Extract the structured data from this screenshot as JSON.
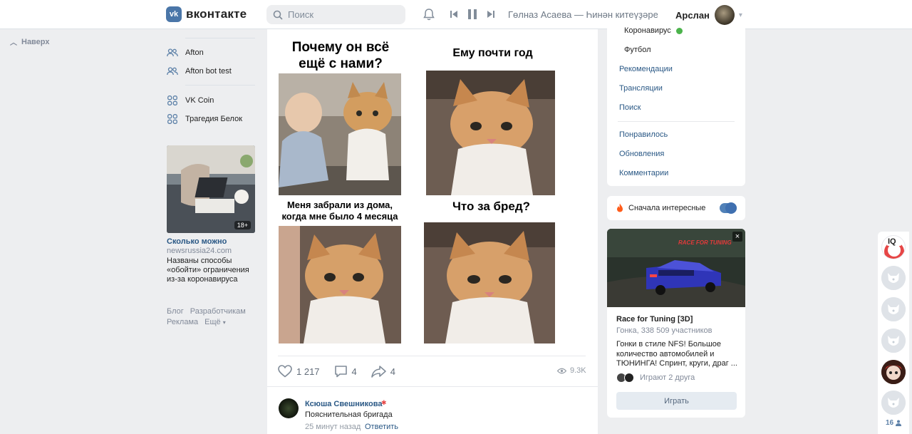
{
  "header": {
    "logo_mark": "vk",
    "logo_text": "вконтакте",
    "search_placeholder": "Поиск",
    "track": "Гөлназ Асаева — Һинән китеүҙәре...",
    "user_name": "Арслан"
  },
  "up_link": "Наверх",
  "left_nav": {
    "groups": [
      {
        "label": "Afton",
        "icon": "users-icon"
      },
      {
        "label": "Afton bot test",
        "icon": "users-icon"
      }
    ],
    "apps": [
      {
        "label": "VK Coin",
        "icon": "apps-icon"
      },
      {
        "label": "Трагедия Белок",
        "icon": "apps-icon"
      }
    ],
    "ad": {
      "badge": "18+",
      "title": "Сколько можно",
      "domain": "newsrussia24.com",
      "description": "Названы способы «обойти» ограничения из-за коронавируса"
    },
    "footer_row1": [
      "Блог",
      "Разработчикам"
    ],
    "footer_row2": [
      "Реклама",
      "Ещё"
    ]
  },
  "post": {
    "captions": {
      "top_left": "Почему он всё ещё с нами?",
      "top_right": "Ему почти год",
      "bottom_left": "Меня забрали из дома, когда мне было 4 месяца",
      "bottom_right": "Что за бред?"
    },
    "likes": "1 217",
    "comments": "4",
    "shares": "4",
    "views": "9.3K"
  },
  "comment": {
    "author": "Ксюша Свешникова",
    "flag": "✱",
    "text": "Пояснительная бригада",
    "time": "25 минут назад",
    "reply": "Ответить"
  },
  "right": {
    "sub_items": [
      "Коронавирус",
      "Футбол"
    ],
    "links1": [
      "Рекомендации",
      "Трансляции",
      "Поиск"
    ],
    "links2": [
      "Понравилось",
      "Обновления",
      "Комментарии"
    ],
    "interesting_label": "Сначала интересные",
    "interesting_on": true,
    "game": {
      "title": "Race for Tuning [3D]",
      "meta": "Гонка, 338 509 участников",
      "description": "Гонки в стиле NFS! Большое количество автомобилей и ТЮНИНГА! Спринт, круги, драг ...",
      "friends": "Играют 2 друга",
      "play": "Играть",
      "logo_text": "RACE FOR TUNING"
    }
  },
  "rail": {
    "iq_label": "IQ",
    "online_count": "16"
  },
  "colors": {
    "brand": "#4a76a8",
    "link": "#2a5885",
    "bg": "#edeef0"
  }
}
